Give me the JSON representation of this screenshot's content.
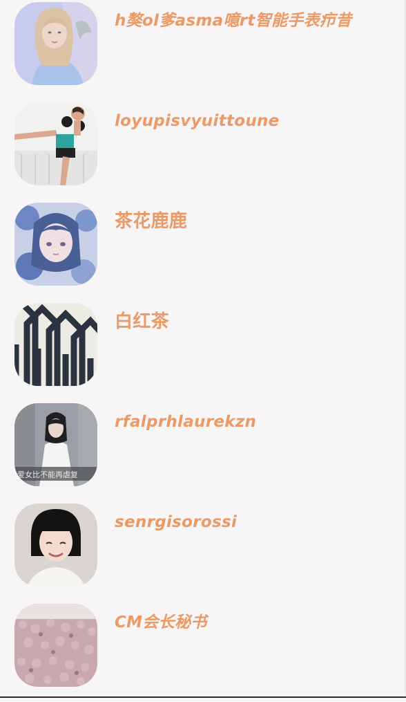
{
  "contacts": [
    {
      "name": "h獒ol爹asma噫rt智能手表疖昔",
      "avatar": "woman-blonde-avatar"
    },
    {
      "name": "loyupisvyuittoune",
      "avatar": "kickboxer-avatar"
    },
    {
      "name": "茶花鹿鹿",
      "avatar": "anime-girl-flowers-avatar"
    },
    {
      "name": "白红茶",
      "avatar": "geometric-pattern-avatar"
    },
    {
      "name": "rfalprhlaurekzn",
      "avatar": "girl-white-dress-avatar"
    },
    {
      "name": "senrgisorossi",
      "avatar": "girl-bob-haircut-avatar"
    },
    {
      "name": "CM会长秘书",
      "avatar": "pink-flowers-avatar"
    }
  ],
  "overlay_text": {
    "photo_caption": "爱女比不能再虐复"
  }
}
